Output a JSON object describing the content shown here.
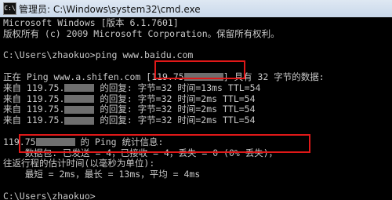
{
  "window": {
    "icon_text": "C:\\",
    "title": "管理员: C:\\Windows\\system32\\cmd.exe"
  },
  "console": {
    "header1": "Microsoft Windows [版本 6.1.7601]",
    "header2": "版权所有 (c) 2009 Microsoft Corporation。保留所有权利。",
    "prompt_cmd": "C:\\Users\\zhaokuo>ping www.baidu.com",
    "ping_start_a": "正在 Ping www.a.shifen.com [119.75",
    "ping_start_b": "] 具有 32 字节的数据:",
    "replies": [
      {
        "ip": "来自 119.75.",
        "rest": " 的回复: 字节=32 时间=13ms TTL=54"
      },
      {
        "ip": "来自 119.75.",
        "rest": " 的回复: 字节=32 时间=2ms TTL=54"
      },
      {
        "ip": "来自 119.75.",
        "rest": " 的回复: 字节=32 时间=2ms TTL=54"
      },
      {
        "ip": "来自 119.75.",
        "rest": " 的回复: 字节=32 时间=2ms TTL=54"
      }
    ],
    "stats_title_a": "119.75",
    "stats_title_b": " 的 Ping 统计信息:",
    "stats_packets": "    数据包: 已发送 = 4，已接收 = 4，丢失 = 0 (0% 丢失)，",
    "rtt_title": "往返行程的估计时间(以毫秒为单位):",
    "rtt_values": "    最短 = 2ms，最长 = 13ms，平均 = 4ms",
    "final_prompt": "C:\\Users\\zhaokuo>"
  },
  "colors": {
    "console_bg": "#000000",
    "console_text": "#c8c8c8",
    "highlight": "#e01818",
    "redaction": "#6e6e6e"
  }
}
